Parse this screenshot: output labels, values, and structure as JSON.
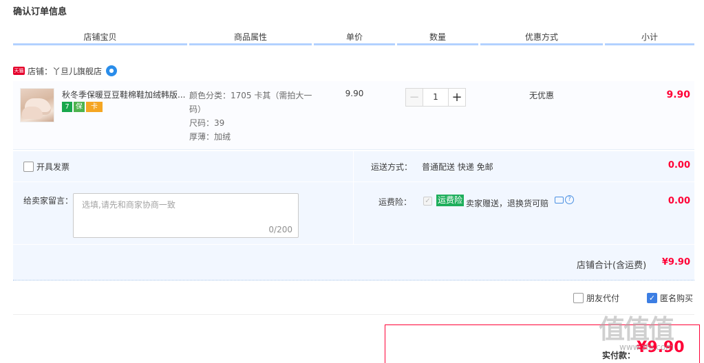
{
  "page": {
    "title": "确认订单信息"
  },
  "columns": [
    "店铺宝贝",
    "商品属性",
    "单价",
    "数量",
    "优惠方式",
    "小计"
  ],
  "shop": {
    "label": "店铺：",
    "name": "丫旦儿旗舰店",
    "tmall_badge": "天猫",
    "brand_color": "#e5002b"
  },
  "item": {
    "title": "秋冬季保暖豆豆鞋棉鞋加绒韩版...",
    "badges": [
      "7",
      "保",
      "卡"
    ],
    "props": [
      "颜色分类：1705 卡其（需拍大一码）",
      "尺码：39",
      "厚薄：加绒"
    ],
    "unit_price": "9.90",
    "quantity": "1",
    "minus": "−",
    "plus": "+",
    "discount": "无优惠",
    "subtotal": "9.90"
  },
  "invoice": {
    "label": "开具发票"
  },
  "shipping": {
    "label": "运送方式：",
    "value": "普通配送 快递 免邮",
    "price": "0.00"
  },
  "message": {
    "label": "给卖家留言：",
    "placeholder": "选填,请先和商家协商一致",
    "counter": "0/200"
  },
  "insurance": {
    "label": "运费险：",
    "tag": "运费险",
    "text": "卖家赠送，退换货可赔",
    "price": "0.00",
    "help": "?"
  },
  "shop_total": {
    "label": "店铺合计(含运费)",
    "value": "¥9.90"
  },
  "options": {
    "friend_pay": "朋友代付",
    "anonymous": "匿名购买"
  },
  "payment": {
    "label": "实付款：",
    "amount": "¥9.90"
  },
  "watermark": {
    "text": "值值值",
    "url": "www.zhi.com"
  },
  "accent_color": "#ff0036"
}
